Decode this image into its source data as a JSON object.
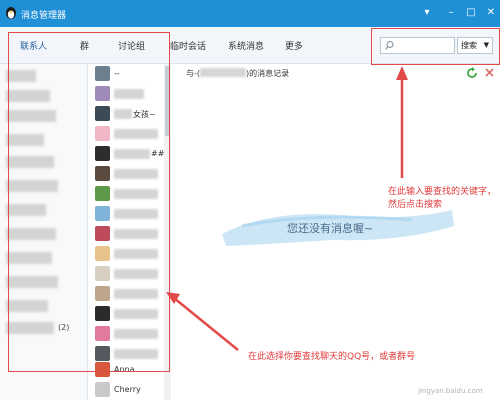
{
  "window": {
    "title": "消息管理器"
  },
  "tabs": [
    {
      "label": "联系人"
    },
    {
      "label": "群"
    },
    {
      "label": "讨论组"
    },
    {
      "label": "临时会话"
    },
    {
      "label": "系统消息"
    },
    {
      "label": "更多"
    }
  ],
  "search": {
    "placeholder": "",
    "button_label": "搜索"
  },
  "groups": [
    {
      "label": ""
    },
    {
      "label": ""
    },
    {
      "label": ""
    },
    {
      "label": ""
    },
    {
      "label": ""
    },
    {
      "label": ""
    },
    {
      "label": ""
    },
    {
      "label": ""
    },
    {
      "label": ""
    },
    {
      "label": ""
    },
    {
      "label": ""
    },
    {
      "label": ""
    },
    {
      "label": "(2)"
    }
  ],
  "contacts": [
    {
      "name": "--"
    },
    {
      "name": ""
    },
    {
      "name": "女孩~"
    },
    {
      "name": ""
    },
    {
      "name": "##"
    },
    {
      "name": ""
    },
    {
      "name": ""
    },
    {
      "name": ""
    },
    {
      "name": ""
    },
    {
      "name": ""
    },
    {
      "name": ""
    },
    {
      "name": ""
    },
    {
      "name": ""
    },
    {
      "name": ""
    },
    {
      "name": ""
    },
    {
      "name": "Anna"
    },
    {
      "name": "Cherry"
    }
  ],
  "content": {
    "record_prefix": "与-(",
    "record_suffix": ")的消息记录",
    "empty_message": "您还没有消息喔~"
  },
  "annotations": {
    "search_hint": "在此输入要查找的关键字，然后点击搜索",
    "contact_hint": "在此选择你要查找聊天的QQ号，或者群号"
  },
  "watermark": "jingyan.baidu.com",
  "colors": {
    "titlebar": "#1f8fd6",
    "annotation": "#e24a4a",
    "active_tab": "#2a5f9e"
  }
}
